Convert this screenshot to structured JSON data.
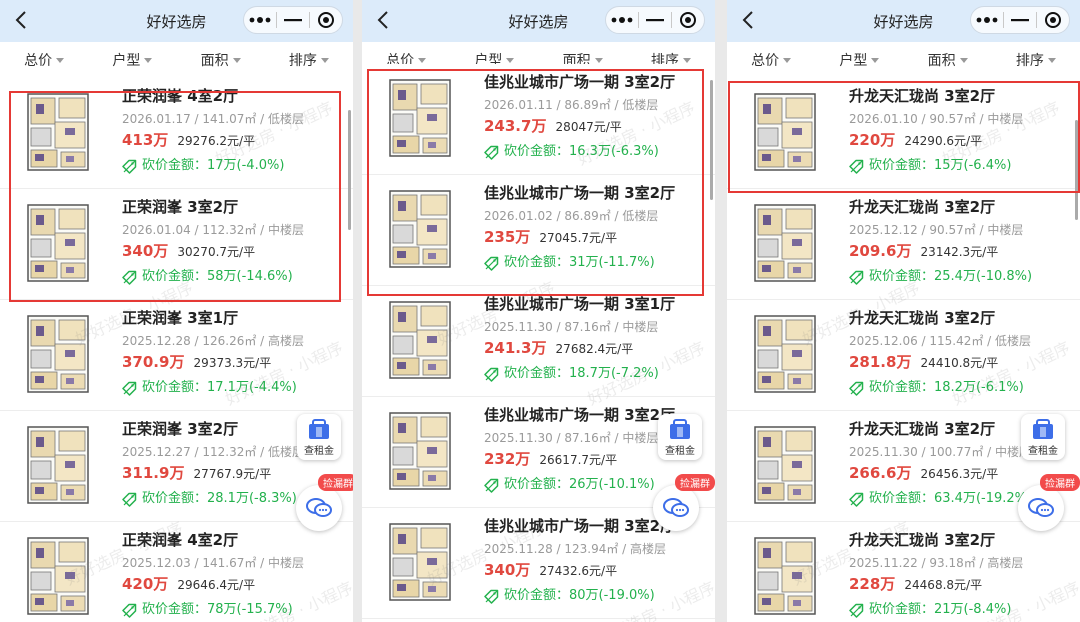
{
  "colors": {
    "price": "#e0483f",
    "cut": "#23b14d",
    "nav_bg": "#dcebfa",
    "highlight": "#e53935"
  },
  "app": {
    "title": "好好选房",
    "watermark": "好好选房 · 小程序"
  },
  "filters": [
    "总价",
    "户型",
    "面积",
    "排序"
  ],
  "fab": {
    "rent_label": "查租金",
    "chat_badge": "捡漏群"
  },
  "panels": [
    {
      "listings": [
        {
          "title": "正荣润峯 4室2厅",
          "meta": "2026.01.17 / 141.07㎡ / 低楼层",
          "price": "413万",
          "unit_price": "29276.2元/平",
          "cut": "砍价金额：17万(-4.0%)"
        },
        {
          "title": "正荣润峯 3室2厅",
          "meta": "2026.01.04 / 112.32㎡ / 中楼层",
          "price": "340万",
          "unit_price": "30270.7元/平",
          "cut": "砍价金额：58万(-14.6%)"
        },
        {
          "title": "正荣润峯 3室1厅",
          "meta": "2025.12.28 / 126.26㎡ / 高楼层",
          "price": "370.9万",
          "unit_price": "29373.3元/平",
          "cut": "砍价金额：17.1万(-4.4%)"
        },
        {
          "title": "正荣润峯 3室2厅",
          "meta": "2025.12.27 / 112.32㎡ / 低楼层",
          "price": "311.9万",
          "unit_price": "27767.9元/平",
          "cut": "砍价金额：28.1万(-8.3%)"
        },
        {
          "title": "正荣润峯 4室2厅",
          "meta": "2025.12.03 / 141.67㎡ / 中楼层",
          "price": "420万",
          "unit_price": "29646.4元/平",
          "cut": "砍价金额：78万(-15.7%)"
        }
      ]
    },
    {
      "listings": [
        {
          "title": "佳兆业城市广场一期 3室2厅",
          "meta": "2026.01.11 / 86.89㎡ / 低楼层",
          "price": "243.7万",
          "unit_price": "28047元/平",
          "cut": "砍价金额：16.3万(-6.3%)"
        },
        {
          "title": "佳兆业城市广场一期 3室2厅",
          "meta": "2026.01.02 / 86.89㎡ / 低楼层",
          "price": "235万",
          "unit_price": "27045.7元/平",
          "cut": "砍价金额：31万(-11.7%)"
        },
        {
          "title": "佳兆业城市广场一期 3室1厅",
          "meta": "2025.11.30 / 87.16㎡ / 中楼层",
          "price": "241.3万",
          "unit_price": "27682.4元/平",
          "cut": "砍价金额：18.7万(-7.2%)"
        },
        {
          "title": "佳兆业城市广场一期 3室2厅",
          "meta": "2025.11.30 / 87.16㎡ / 中楼层",
          "price": "232万",
          "unit_price": "26617.7元/平",
          "cut": "砍价金额：26万(-10.1%)"
        },
        {
          "title": "佳兆业城市广场一期 3室2厅",
          "meta": "2025.11.28 / 123.94㎡ / 高楼层",
          "price": "340万",
          "unit_price": "27432.6元/平",
          "cut": "砍价金额：80万(-19.0%)"
        }
      ]
    },
    {
      "listings": [
        {
          "title": "升龙天汇珑尚 3室2厅",
          "meta": "2026.01.10 / 90.57㎡ / 中楼层",
          "price": "220万",
          "unit_price": "24290.6元/平",
          "cut": "砍价金额：15万(-6.4%)"
        },
        {
          "title": "升龙天汇珑尚 3室2厅",
          "meta": "2025.12.12 / 90.57㎡ / 中楼层",
          "price": "209.6万",
          "unit_price": "23142.3元/平",
          "cut": "砍价金额：25.4万(-10.8%)"
        },
        {
          "title": "升龙天汇珑尚 3室2厅",
          "meta": "2025.12.06 / 115.42㎡ / 低楼层",
          "price": "281.8万",
          "unit_price": "24410.8元/平",
          "cut": "砍价金额：18.2万(-6.1%)"
        },
        {
          "title": "升龙天汇珑尚 3室2厅",
          "meta": "2025.11.30 / 100.77㎡ / 中楼层",
          "price": "266.6万",
          "unit_price": "26456.3元/平",
          "cut": "砍价金额：63.4万(-19.2%)"
        },
        {
          "title": "升龙天汇珑尚 3室2厅",
          "meta": "2025.11.22 / 93.18㎡ / 高楼层",
          "price": "228万",
          "unit_price": "24468.8元/平",
          "cut": "砍价金额：21万(-8.4%)"
        }
      ]
    }
  ]
}
